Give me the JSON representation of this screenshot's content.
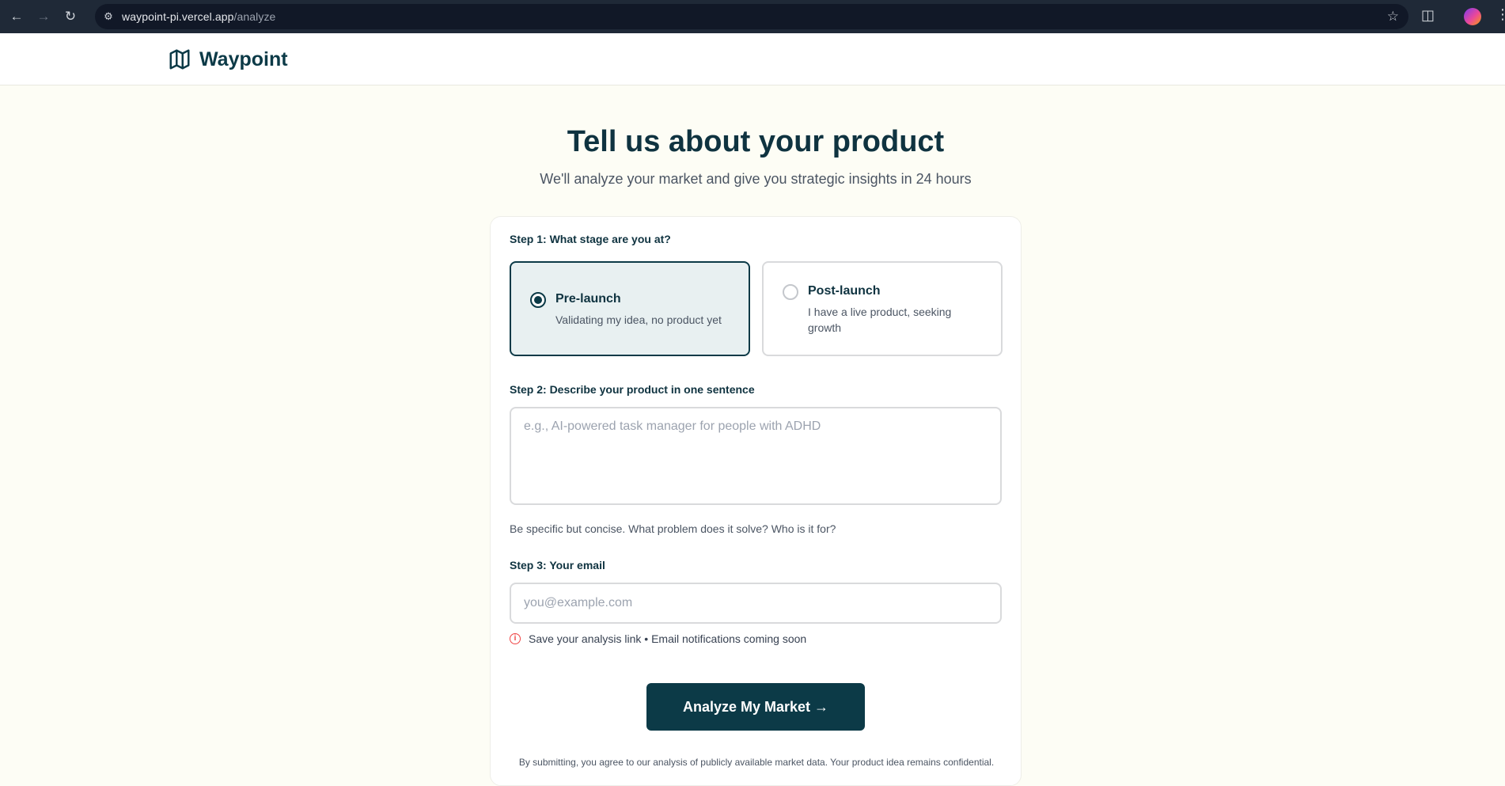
{
  "browser": {
    "url_host": "waypoint-pi.vercel.app",
    "url_path": "/analyze"
  },
  "header": {
    "brand": "Waypoint",
    "logo_icon": "map-icon"
  },
  "main": {
    "title": "Tell us about your product",
    "subtitle": "We'll analyze your market and give you strategic insights in 24 hours"
  },
  "form": {
    "step1": {
      "label": "Step 1: What stage are you at?",
      "options": [
        {
          "title": "Pre-launch",
          "desc": "Validating my idea, no product yet",
          "selected": true
        },
        {
          "title": "Post-launch",
          "desc": "I have a live product, seeking growth",
          "selected": false
        }
      ]
    },
    "step2": {
      "label": "Step 2: Describe your product in one sentence",
      "placeholder": "e.g., AI-powered task manager for people with ADHD",
      "value": "",
      "hint": "Be specific but concise. What problem does it solve? Who is it for?"
    },
    "step3": {
      "label": "Step 3: Your email",
      "placeholder": "you@example.com",
      "value": "",
      "notice": "Save your analysis link • Email notifications coming soon",
      "notice_icon": "info-icon"
    },
    "submit_label": "Analyze My Market →",
    "fineprint": "By submitting, you agree to our analysis of publicly available market data. Your product idea remains confidential."
  },
  "colors": {
    "primary": "#0c3a47",
    "selected_bg": "#e8f0f1",
    "page_bg": "#fdfdf5",
    "notice_icon": "#ef4444"
  }
}
